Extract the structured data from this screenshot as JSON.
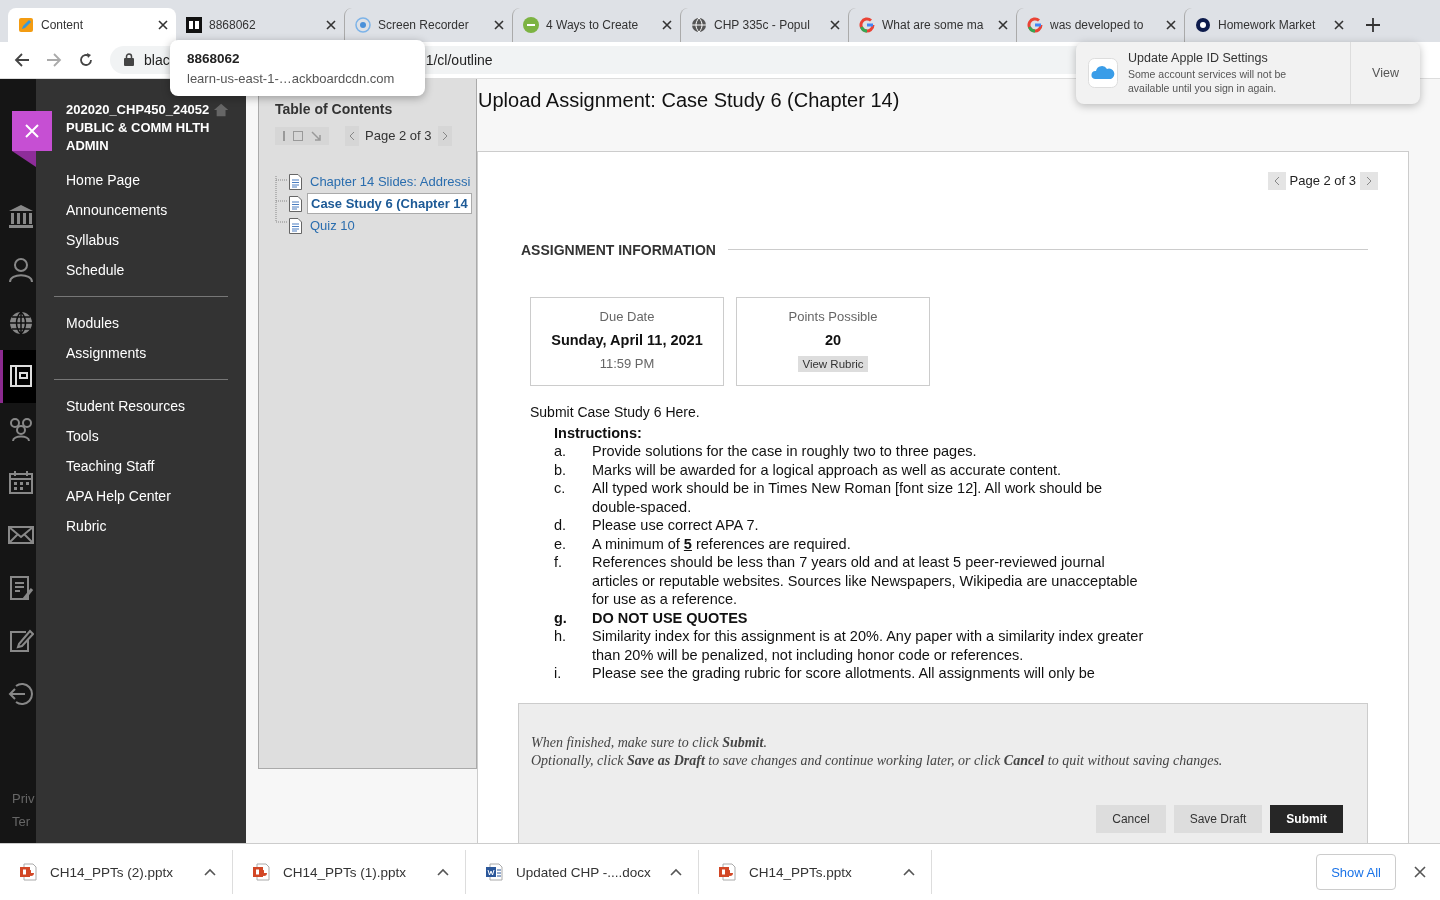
{
  "browser": {
    "tabs": [
      {
        "title": "Content",
        "kind": "pencil",
        "selected": true
      },
      {
        "title": "8868062",
        "kind": "bb",
        "selected": false
      },
      {
        "title": "Screen Recorder",
        "kind": "recorder",
        "selected": false
      },
      {
        "title": "4 Ways to Create",
        "kind": "wh",
        "selected": false
      },
      {
        "title": "CHP 335c - Popul",
        "kind": "globe",
        "selected": false
      },
      {
        "title": "What are some ma",
        "kind": "google",
        "selected": false
      },
      {
        "title": "was developed to",
        "kind": "google",
        "selected": false
      },
      {
        "title": "Homework Market",
        "kind": "hm",
        "selected": false
      }
    ]
  },
  "address_bar": {
    "url_start": "blac",
    "url_end": "1/cl/outline"
  },
  "tooltip": {
    "title": "8868062",
    "url": "learn-us-east-1-…ackboardcdn.com"
  },
  "notification": {
    "title": "Update Apple ID Settings",
    "message": "Some account services will not be available until you sign in again.",
    "action": "View"
  },
  "rail": {
    "items": [
      {
        "kind": "institution",
        "selected": false
      },
      {
        "kind": "person",
        "selected": false
      },
      {
        "kind": "globe",
        "selected": false
      },
      {
        "kind": "courses",
        "selected": true
      },
      {
        "kind": "groups",
        "selected": false
      },
      {
        "kind": "calendar",
        "selected": false
      },
      {
        "kind": "mail",
        "selected": false
      },
      {
        "kind": "grades",
        "selected": false
      },
      {
        "kind": "edit",
        "selected": false
      },
      {
        "kind": "signout",
        "selected": false
      }
    ],
    "footer_links": [
      "Priv",
      "Ter"
    ]
  },
  "course_menu": {
    "title": "202020_CHP450_24052 PUBLIC & COMM HLTH ADMIN",
    "sections": [
      [
        "Home Page",
        "Announcements",
        "Syllabus",
        "Schedule"
      ],
      [
        "Modules",
        "Assignments"
      ],
      [
        "Student Resources",
        "Tools",
        "Teaching Staff",
        "APA Help Center",
        "Rubric"
      ]
    ]
  },
  "toc": {
    "heading": "Table of Contents",
    "pager": "Page 2 of 3",
    "items": [
      {
        "label": "Chapter 14 Slides: Addressi",
        "selected": false
      },
      {
        "label": "Case Study 6 (Chapter 14",
        "selected": true
      },
      {
        "label": "Quiz 10",
        "selected": false
      }
    ]
  },
  "assignment": {
    "title": "Upload Assignment: Case Study 6 (Chapter 14)",
    "pager": "Page 2 of 3",
    "section_heading": "ASSIGNMENT INFORMATION",
    "due": {
      "label": "Due Date",
      "date": "Sunday, April 11, 2021",
      "time": "11:59 PM"
    },
    "points": {
      "label": "Points Possible",
      "value": "20",
      "button": "View Rubric"
    },
    "intro": "Submit Case Study 6 Here.",
    "instructions_heading": "Instructions:",
    "instructions": [
      {
        "marker": "a.",
        "text": "Provide solutions for the case in roughly two to three pages.",
        "bold": false
      },
      {
        "marker": "b.",
        "text": "Marks will be awarded for a logical approach as well as accurate content.",
        "bold": false
      },
      {
        "marker": "c.",
        "text": "All typed work should be in Times New Roman [font size 12]. All work should be double-spaced.",
        "bold": false
      },
      {
        "marker": "d.",
        "text": "Please use correct APA 7.",
        "bold": false
      },
      {
        "marker": "e.",
        "text": "A minimum of **5** references are required.",
        "bold": false
      },
      {
        "marker": "f.",
        "text": "References should be less than 7 years old and at least 5 peer-reviewed journal articles or reputable websites. Sources like Newspapers, Wikipedia are unacceptable for use as a reference.",
        "bold": false
      },
      {
        "marker": "g.",
        "text": "DO NOT USE QUOTES",
        "bold": true
      },
      {
        "marker": "h.",
        "text": "Similarity index for this assignment is at 20%. Any paper with a similarity index greater than 20% will be penalized, not including honor code  or references.",
        "bold": false
      },
      {
        "marker": "i.",
        "text": "Please see the grading rubric for score allotments. All assignments will only be",
        "bold": false
      }
    ]
  },
  "submit_panel": {
    "lines": [
      "When finished, make sure to click **Submit**.",
      "Optionally, click **Save as Draft** to save changes and continue working later, or click **Cancel** to quit without saving changes."
    ],
    "buttons": [
      {
        "label": "Cancel",
        "kind": "secondary"
      },
      {
        "label": "Save Draft",
        "kind": "secondary"
      },
      {
        "label": "Submit",
        "kind": "primary"
      }
    ]
  },
  "downloads": {
    "items": [
      {
        "name": "CH14_PPTs (2).pptx",
        "kind": "pptx"
      },
      {
        "name": "CH14_PPTs (1).pptx",
        "kind": "pptx"
      },
      {
        "name": "Updated CHP -....docx",
        "kind": "docx"
      },
      {
        "name": "CH14_PPTs.pptx",
        "kind": "pptx"
      }
    ],
    "show_all": "Show All"
  }
}
